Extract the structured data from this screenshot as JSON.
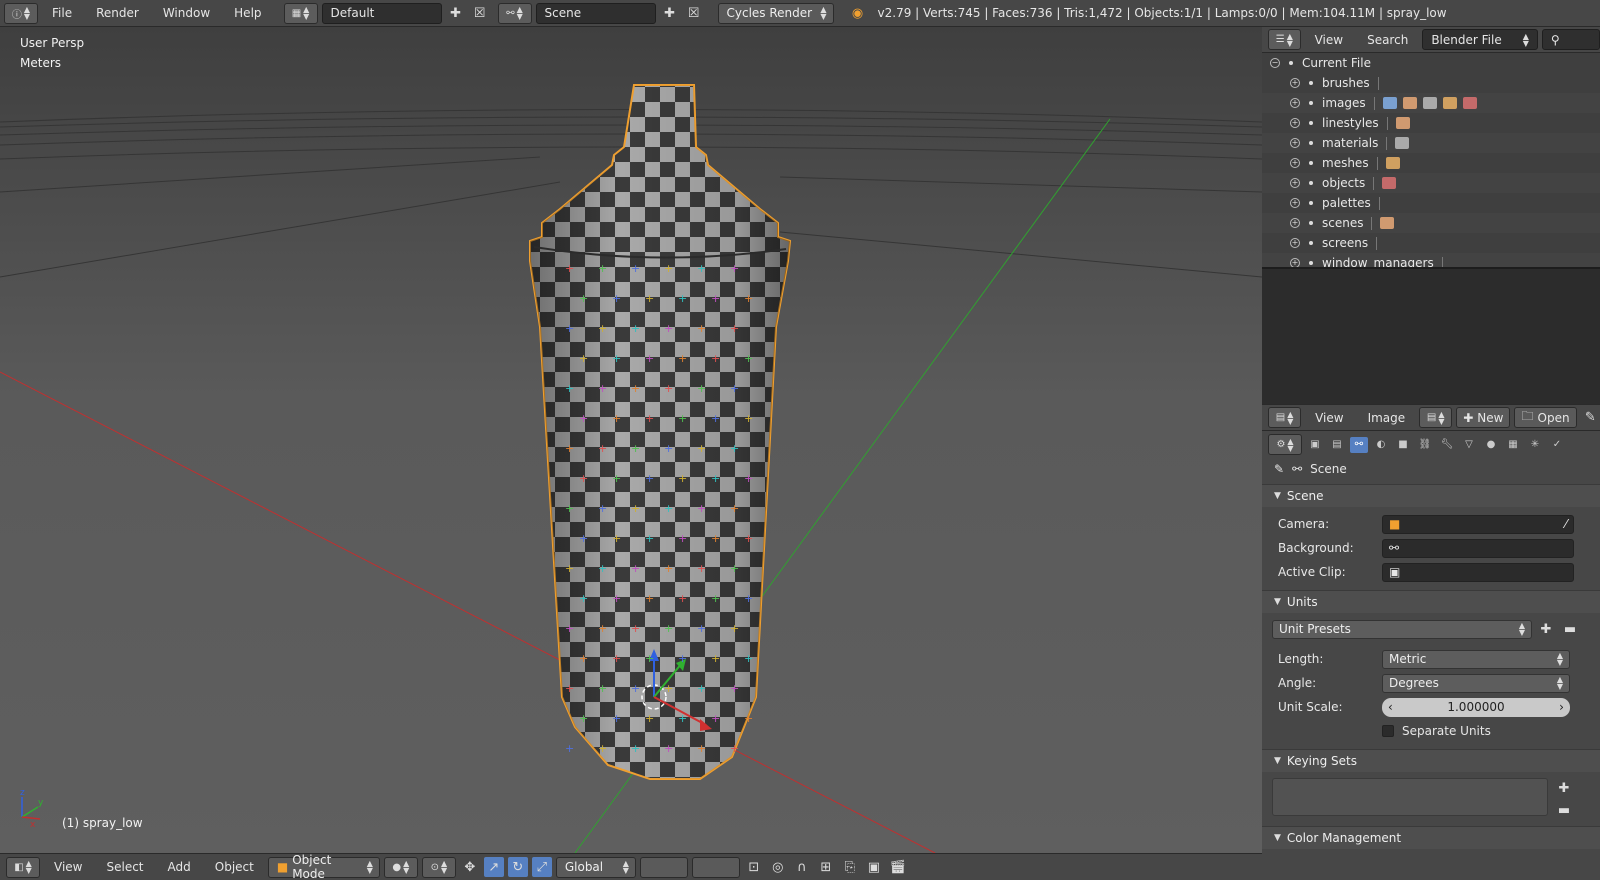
{
  "topbar": {
    "menus": [
      "File",
      "Render",
      "Window",
      "Help"
    ],
    "layout_name": "Default",
    "scene_name": "Scene",
    "render_engine": "Cycles Render",
    "stats": "v2.79 | Verts:745 | Faces:736 | Tris:1,472 | Objects:1/1 | Lamps:0/0 | Mem:104.11M | spray_low"
  },
  "viewport": {
    "view_name": "User Persp",
    "units_label": "Meters",
    "object_label": "(1) spray_low",
    "axes": {
      "x": "x",
      "y": "y",
      "z": "z"
    }
  },
  "bottombar": {
    "menus": [
      "View",
      "Select",
      "Add",
      "Object"
    ],
    "mode": "Object Mode",
    "orientation": "Global"
  },
  "outliner": {
    "header": {
      "view": "View",
      "search": "Search",
      "display_mode": "Blender File"
    },
    "root": "Current File",
    "items": [
      {
        "label": "brushes",
        "icons": 0
      },
      {
        "label": "images",
        "icons": 5
      },
      {
        "label": "linestyles",
        "icons": 1
      },
      {
        "label": "materials",
        "icons": 1
      },
      {
        "label": "meshes",
        "icons": 1
      },
      {
        "label": "objects",
        "icons": 1
      },
      {
        "label": "palettes",
        "icons": 0
      },
      {
        "label": "scenes",
        "icons": 1
      },
      {
        "label": "screens",
        "icons": 0
      },
      {
        "label": "window_managers",
        "icons": 0
      }
    ]
  },
  "image_header": {
    "view": "View",
    "image": "Image",
    "new": "New",
    "open": "Open"
  },
  "properties": {
    "context": "Scene",
    "panels": {
      "scene": {
        "title": "Scene",
        "camera_label": "Camera:",
        "background_label": "Background:",
        "active_clip_label": "Active Clip:"
      },
      "units": {
        "title": "Units",
        "presets": "Unit Presets",
        "length_label": "Length:",
        "length_value": "Metric",
        "angle_label": "Angle:",
        "angle_value": "Degrees",
        "unit_scale_label": "Unit Scale:",
        "unit_scale_value": "1.000000",
        "separate_units": "Separate Units"
      },
      "keying_sets": {
        "title": "Keying Sets"
      },
      "color_management": {
        "title": "Color Management"
      }
    }
  },
  "colors": {
    "accent": "#5680c2",
    "selection_outline": "#f0a030",
    "axis_x": "#c03030",
    "axis_y": "#30b030",
    "axis_z": "#3060e0"
  }
}
